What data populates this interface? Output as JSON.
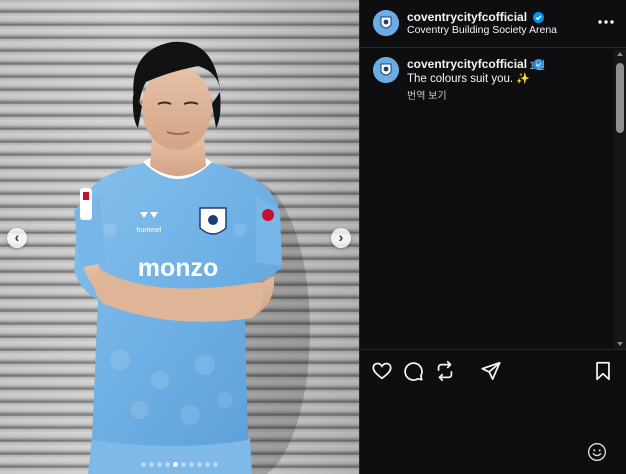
{
  "post": {
    "header": {
      "username": "coventrycityfcofficial",
      "location": "Coventry Building Society Arena",
      "avatar_icon": "coventry-city-badge-icon",
      "more_icon": "more-horizontal-icon"
    },
    "caption": {
      "username": "coventrycityfcofficial",
      "time": "1일",
      "text": "The colours suit you.",
      "emoji": "✨",
      "translate_label": "번역 보기"
    },
    "actions": [
      "like-icon",
      "comment-icon",
      "repost-icon",
      "share-icon",
      "save-icon"
    ],
    "footer": {
      "emoji_icon": "emoji-smiley-icon"
    }
  },
  "media": {
    "shirt_sponsor": "monzo",
    "shirt_brand": "hummel",
    "prev_icon": "chevron-left-icon",
    "next_icon": "chevron-right-icon",
    "carousel": {
      "total": 10,
      "active": 5
    }
  },
  "colors": {
    "background": "#000000",
    "panel": "#0e0e10",
    "sky_blue": "#6cace4",
    "verified": "#0095f6",
    "muted_text": "#a8a8a8"
  }
}
